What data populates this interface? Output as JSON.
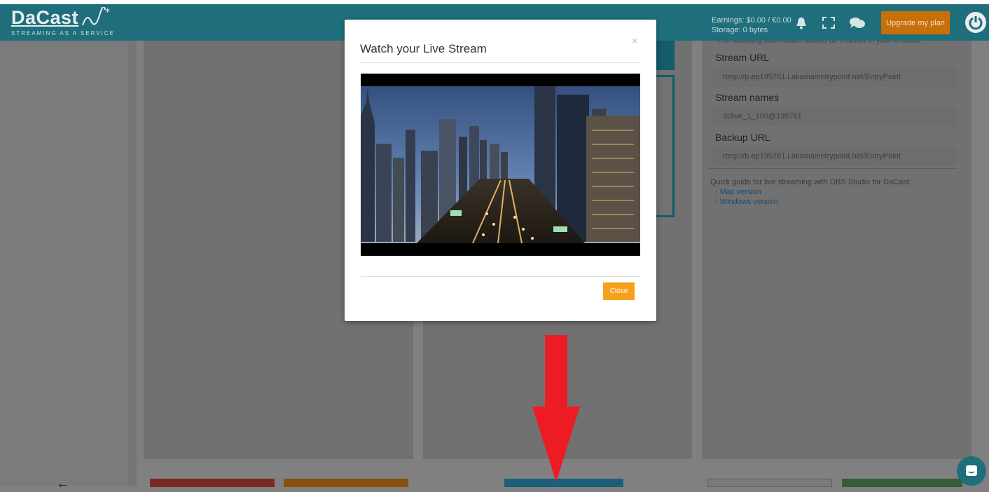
{
  "brand": {
    "name": "DaCast",
    "tagline": "STREAMING AS A SERVICE"
  },
  "header": {
    "earnings": "Earnings: $0.00 / €0.00",
    "storage": "Storage: 0 bytes",
    "icons": [
      "bell-icon",
      "fullscreen-icon",
      "chat-icon",
      "power-icon"
    ],
    "upgrade_label": "Upgrade my plan"
  },
  "encoder": {
    "intro": "The following information should be entered in your encoder:",
    "stream_url_label": "Stream URL",
    "stream_url": "rtmp://p.ep195761.i.akamaientrypoint.net/EntryPoint",
    "stream_names_label": "Stream names",
    "stream_name": "dclive_1_150@195761",
    "backup_url_label": "Backup URL",
    "backup_url": "rtmp://b.ep195761.i.akamaientrypoint.net/EntryPoint",
    "guide_text": "Quick guide for live streaming with OBS Studio for DaCast:",
    "guide_links": [
      "- Mac version",
      "- Windows version"
    ]
  },
  "modal": {
    "title": "Watch your Live Stream",
    "close_x": "×",
    "close_label": "Close"
  },
  "bottom_bar": {
    "buttons": [
      {
        "name": "delete-button",
        "color": "#7a2a24"
      },
      {
        "name": "settings-button",
        "color": "#86510f"
      },
      {
        "name": "preview-button",
        "color": "#1b5f7b"
      },
      {
        "name": "back-button",
        "color": "#7a7a7a"
      },
      {
        "name": "save-button",
        "color": "#355e37"
      }
    ]
  },
  "colors": {
    "header": "#1f6e7c",
    "upgrade": "#c86f09",
    "close_button": "#f5a11c",
    "annotation_arrow": "#ed1c24"
  }
}
